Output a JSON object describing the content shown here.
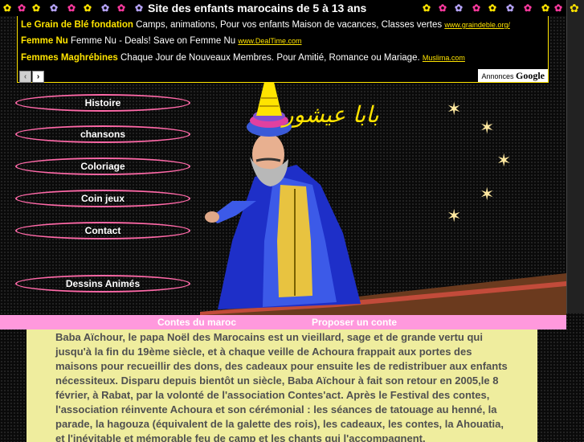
{
  "header": {
    "title": "Site des enfants marocains de 5 à 13 ans",
    "flower_colors": [
      "#ff3aa0",
      "#ffe400",
      "#b9a6ff",
      "#ff3aa0",
      "#ffe400",
      "#b9a6ff",
      "#ff3aa0",
      "#ffe400"
    ]
  },
  "ads": {
    "items": [
      {
        "label": "Le Grain de Blé fondation",
        "text": "Camps, animations, Pour vos enfants Maison de vacances, Classes vertes",
        "url": "www.graindeble.org/"
      },
      {
        "label": "Femme Nu",
        "text": "Femme Nu - Deals! Save on Femme Nu",
        "url": "www.DealTime.com"
      },
      {
        "label": "Femmes Maghrébines",
        "text": "Chaque Jour de Nouveaux Membres. Pour Amitié, Romance ou Mariage.",
        "url": "Muslima.com"
      }
    ],
    "prev_icon": "chevron-left-icon",
    "next_icon": "chevron-right-icon",
    "annonces_label": "Annonces",
    "google_label": "Google"
  },
  "menu": {
    "items": [
      "Histoire",
      "chansons",
      "Coloriage",
      "Coin jeux",
      "Contact",
      "Dessins Animés"
    ]
  },
  "hero": {
    "arabic_title": "بابا عيشور"
  },
  "tabs": {
    "contes": "Contes du maroc",
    "proposer": "Proposer un conte"
  },
  "story": {
    "text": "Baba Aïchour, le papa Noël des Marocains est un vieillard, sage et de grande vertu qui jusqu'à la fin du 19ème siècle, et à chaque veille de Achoura frappait aux portes des maisons pour recueillir des dons, des cadeaux pour ensuite les de redistribuer aux enfants nécessiteux. Disparu depuis bientôt un siècle, Baba Aïchour à fait son retour en 2005,le 8 février, à Rabat, par la volonté de l'association Contes'act. Après le Festival des contes, l'association réinvente Achoura et son cérémonial : les séances de tatouage au henné, la parade, la hagouza (équivalent de la galette des rois), les cadeaux, les contes, la Ahouatia, et l'inévitable et mémorable feu de camp et les chants qui l'accompagnent."
  },
  "colors": {
    "accent_yellow": "#ffe400",
    "pink": "#ff99dd",
    "menu_border": "#ff69a8",
    "panel_bg": "#efed9e"
  }
}
